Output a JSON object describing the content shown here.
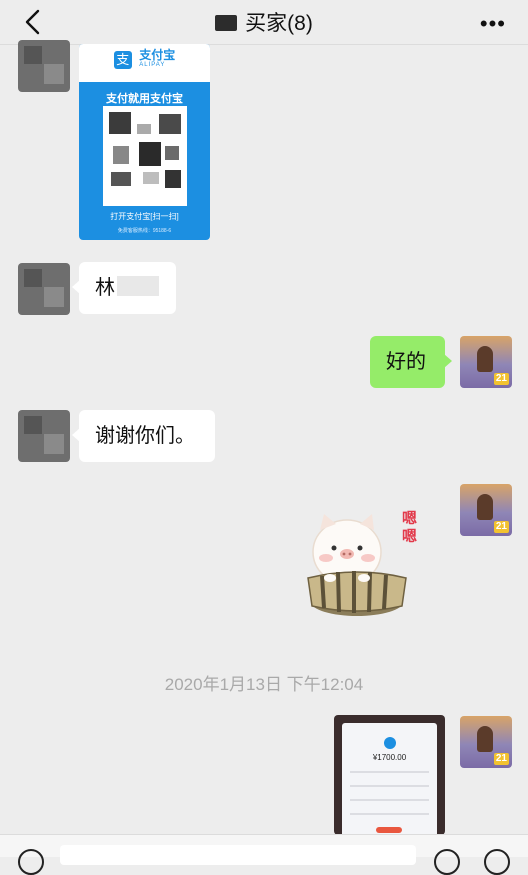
{
  "header": {
    "title": "买家(8)",
    "more_label": "•••"
  },
  "messages": {
    "alipay_card": {
      "brand_cn": "支付宝",
      "brand_en": "ALIPAY",
      "slogan": "支付就用支付宝",
      "open_text": "打开支付宝[扫一扫]",
      "fine_print": "免费客服热线：95188-6"
    },
    "msg_lin": "林",
    "msg_ok": "好的",
    "msg_thanks": "谢谢你们。",
    "sticker_text": "嗯嗯",
    "timestamp": "2020年1月13日 下午12:04",
    "photo_amount": "¥1700.00"
  },
  "avatars": {
    "badge": "21"
  },
  "colors": {
    "background": "#ededed",
    "self_bubble": "#95ec69",
    "alipay_blue": "#1c8fe1"
  },
  "icons": [
    "back-arrow-icon",
    "more-icon",
    "voice-icon",
    "emoji-icon",
    "add-icon"
  ]
}
